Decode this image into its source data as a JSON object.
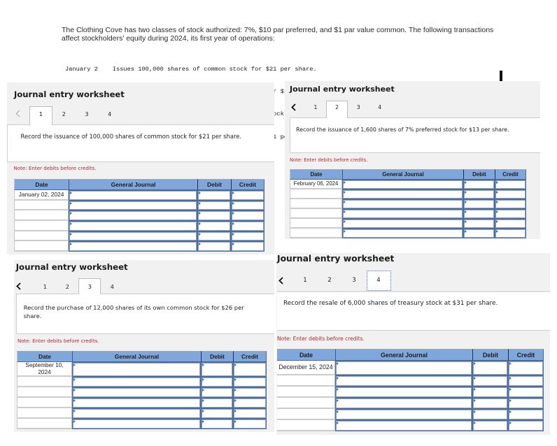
{
  "problem": {
    "intro": "The Clothing Cove has two classes of stock authorized: 7%, $10 par preferred, and $1 par value common. The following transactions affect stockholders’ equity during 2024, its first year of operations:",
    "transactions": [
      {
        "date": "January 2",
        "description": "Issues 100,000 shares of common stock for $21 per share."
      },
      {
        "date": "February 6",
        "description": "Issues 1,600 shares of 7% preferred stock for $13 per share."
      },
      {
        "date": "September 10",
        "description": "Purchases 12,000 shares of its own common stock for $26 per share."
      },
      {
        "date": "December 15",
        "description": "Resells 6,000 shares of treasury stock at $31 per share."
      }
    ]
  },
  "worksheets": [
    {
      "title": "Journal entry worksheet",
      "prev_icon": "chevron-left-icon",
      "prev_disabled": true,
      "tabs": [
        "1",
        "2",
        "3",
        "4"
      ],
      "active_tab": "1",
      "instruction": "Record the issuance of 100,000 shares of common stock for $21 per share.",
      "note": "Note: Enter debits before credits.",
      "columns": [
        "Date",
        "General Journal",
        "Debit",
        "Credit"
      ],
      "rows": [
        {
          "date": "January 02, 2024",
          "account": "",
          "debit": "",
          "credit": ""
        },
        {
          "date": "",
          "account": "",
          "debit": "",
          "credit": ""
        },
        {
          "date": "",
          "account": "",
          "debit": "",
          "credit": ""
        },
        {
          "date": "",
          "account": "",
          "debit": "",
          "credit": ""
        },
        {
          "date": "",
          "account": "",
          "debit": "",
          "credit": ""
        },
        {
          "date": "",
          "account": "",
          "debit": "",
          "credit": ""
        }
      ]
    },
    {
      "title": "Journal entry worksheet",
      "prev_icon": "chevron-left-icon",
      "prev_disabled": false,
      "tabs": [
        "1",
        "2",
        "3",
        "4"
      ],
      "active_tab": "2",
      "instruction": "Record the issuance of 1,600 shares of 7% preferred stock for $13 per share.",
      "note": "Note: Enter debits before credits.",
      "columns": [
        "Date",
        "General Journal",
        "Debit",
        "Credit"
      ],
      "rows": [
        {
          "date": "February 06, 2024",
          "account": "",
          "debit": "",
          "credit": ""
        },
        {
          "date": "",
          "account": "",
          "debit": "",
          "credit": ""
        },
        {
          "date": "",
          "account": "",
          "debit": "",
          "credit": ""
        },
        {
          "date": "",
          "account": "",
          "debit": "",
          "credit": ""
        },
        {
          "date": "",
          "account": "",
          "debit": "",
          "credit": ""
        },
        {
          "date": "",
          "account": "",
          "debit": "",
          "credit": ""
        }
      ]
    },
    {
      "title": "Journal entry worksheet",
      "prev_icon": "chevron-left-icon",
      "prev_disabled": false,
      "tabs": [
        "1",
        "2",
        "3",
        "4"
      ],
      "active_tab": "3",
      "instruction": "Record the purchase of 12,000 shares of its own common stock for $26 per share.",
      "note": "Note: Enter debits before credits.",
      "columns": [
        "Date",
        "General Journal",
        "Debit",
        "Credit"
      ],
      "rows": [
        {
          "date": "September 10, 2024",
          "account": "",
          "debit": "",
          "credit": ""
        },
        {
          "date": "",
          "account": "",
          "debit": "",
          "credit": ""
        },
        {
          "date": "",
          "account": "",
          "debit": "",
          "credit": ""
        },
        {
          "date": "",
          "account": "",
          "debit": "",
          "credit": ""
        },
        {
          "date": "",
          "account": "",
          "debit": "",
          "credit": ""
        },
        {
          "date": "",
          "account": "",
          "debit": "",
          "credit": ""
        }
      ]
    },
    {
      "title": "Journal entry worksheet",
      "prev_icon": "chevron-left-icon",
      "prev_disabled": false,
      "tabs": [
        "1",
        "2",
        "3",
        "4"
      ],
      "active_tab": "4",
      "instruction": "Record the resale of 6,000 shares of treasury stock at $31 per share.",
      "note": "Note: Enter debits before credits.",
      "columns": [
        "Date",
        "General Journal",
        "Debit",
        "Credit"
      ],
      "rows": [
        {
          "date": "December 15, 2024",
          "account": "",
          "debit": "",
          "credit": ""
        },
        {
          "date": "",
          "account": "",
          "debit": "",
          "credit": ""
        },
        {
          "date": "",
          "account": "",
          "debit": "",
          "credit": ""
        },
        {
          "date": "",
          "account": "",
          "debit": "",
          "credit": ""
        },
        {
          "date": "",
          "account": "",
          "debit": "",
          "credit": ""
        },
        {
          "date": "",
          "account": "",
          "debit": "",
          "credit": ""
        }
      ]
    }
  ]
}
